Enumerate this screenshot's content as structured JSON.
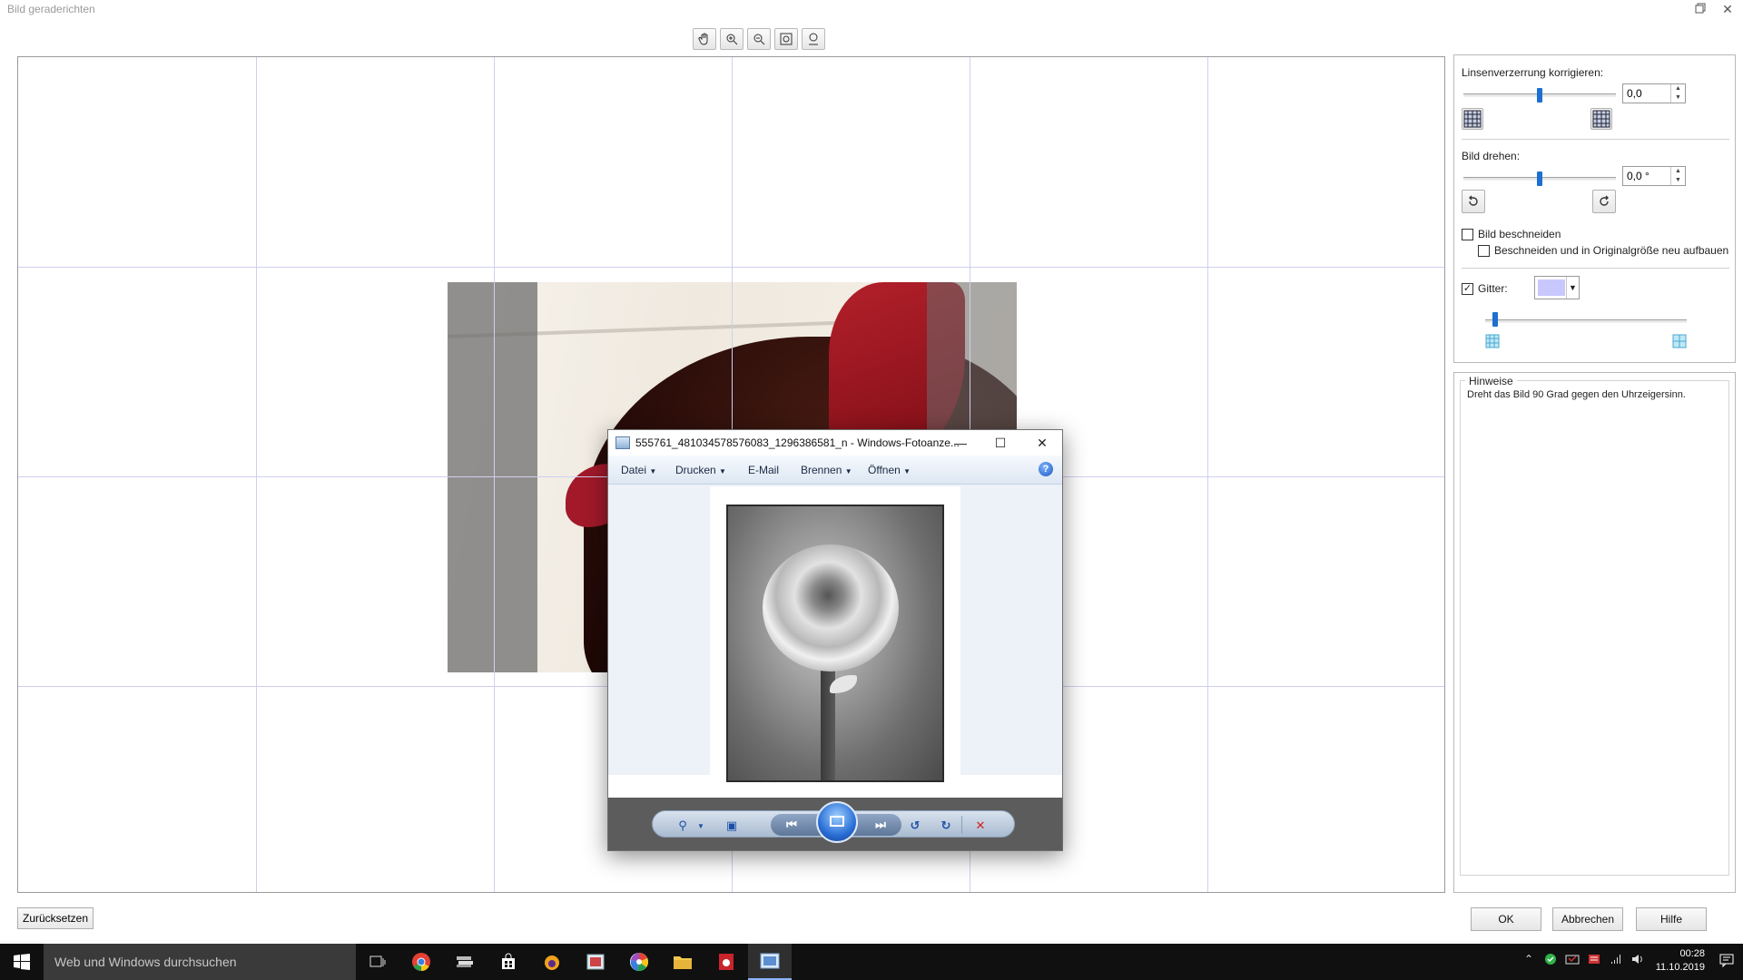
{
  "dialog": {
    "title": "Bild geraderichten",
    "restore_icon": "restore-icon",
    "close_icon": "close-icon"
  },
  "toolbar": {
    "tools": [
      {
        "name": "hand-tool",
        "icon": "hand-icon"
      },
      {
        "name": "zoom-in",
        "icon": "zoom-in-icon"
      },
      {
        "name": "zoom-out",
        "icon": "zoom-out-icon"
      },
      {
        "name": "fit-to-window",
        "icon": "fit-icon"
      },
      {
        "name": "actual-size",
        "icon": "zoom-100-icon"
      }
    ]
  },
  "panel": {
    "lens_label": "Linsenverzerrung korrigieren:",
    "lens_value": "0,0",
    "lens_slider_fraction": 0.5,
    "rotate_label": "Bild drehen:",
    "rotate_value": "0,0 °",
    "rotate_slider_fraction": 0.5,
    "crop_label": "Bild beschneiden",
    "crop_checked": false,
    "crop_rebuild_label": "Beschneiden und in Originalgröße neu aufbauen",
    "crop_rebuild_checked": false,
    "grid_label": "Gitter:",
    "grid_checked": true,
    "grid_color": "#c8c8ff",
    "grid_slider_fraction": 0.05
  },
  "hints": {
    "legend": "Hinweise",
    "text": "Dreht das Bild 90 Grad gegen den Uhrzeigersinn."
  },
  "buttons": {
    "reset": "Zurücksetzen",
    "ok": "OK",
    "cancel": "Abbrechen",
    "help": "Hilfe"
  },
  "viewer": {
    "title": "555761_481034578576083_1296386581_n - Windows-Fotoanze...",
    "menu": [
      {
        "label": "Datei",
        "dropdown": true
      },
      {
        "label": "Drucken",
        "dropdown": true
      },
      {
        "label": "E-Mail",
        "dropdown": false
      },
      {
        "label": "Brennen",
        "dropdown": true
      },
      {
        "label": "Öffnen",
        "dropdown": true
      }
    ],
    "help_glyph": "?"
  },
  "taskbar": {
    "search_placeholder": "Web und Windows durchsuchen",
    "time": "00:28",
    "date": "11.10.2019"
  }
}
